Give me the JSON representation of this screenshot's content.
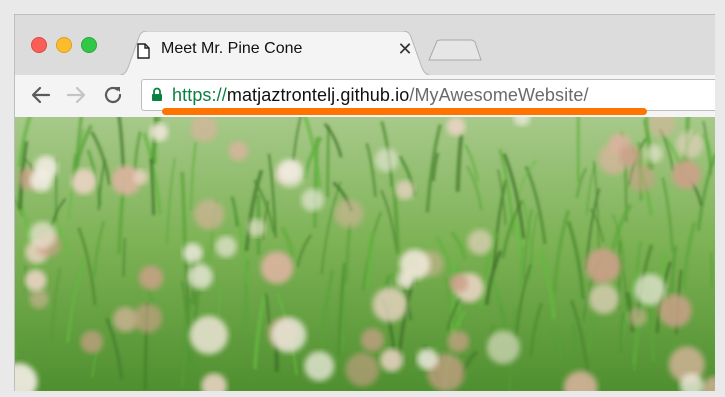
{
  "window": {
    "traffic_lights": [
      "close",
      "minimize",
      "zoom"
    ],
    "colors": {
      "close": "#fc5f57",
      "minimize": "#fdbc2e",
      "zoom": "#33c748"
    }
  },
  "tab": {
    "title": "Meet Mr. Pine Cone",
    "close_glyph": "✕",
    "icon": "document-icon"
  },
  "toolbar": {
    "back_icon": "arrow-left-icon",
    "forward_icon": "arrow-right-icon",
    "reload_icon": "reload-icon"
  },
  "address_bar": {
    "secure_icon": "lock-icon",
    "scheme": "https",
    "separator": "://",
    "host": "matjaztrontelj.github.io",
    "path": "/MyAwesomeWebsite/",
    "scheme_color": "#0b8043"
  },
  "annotation": {
    "underline_color": "#ff7300"
  },
  "content": {
    "image": "clover-field-photo"
  }
}
